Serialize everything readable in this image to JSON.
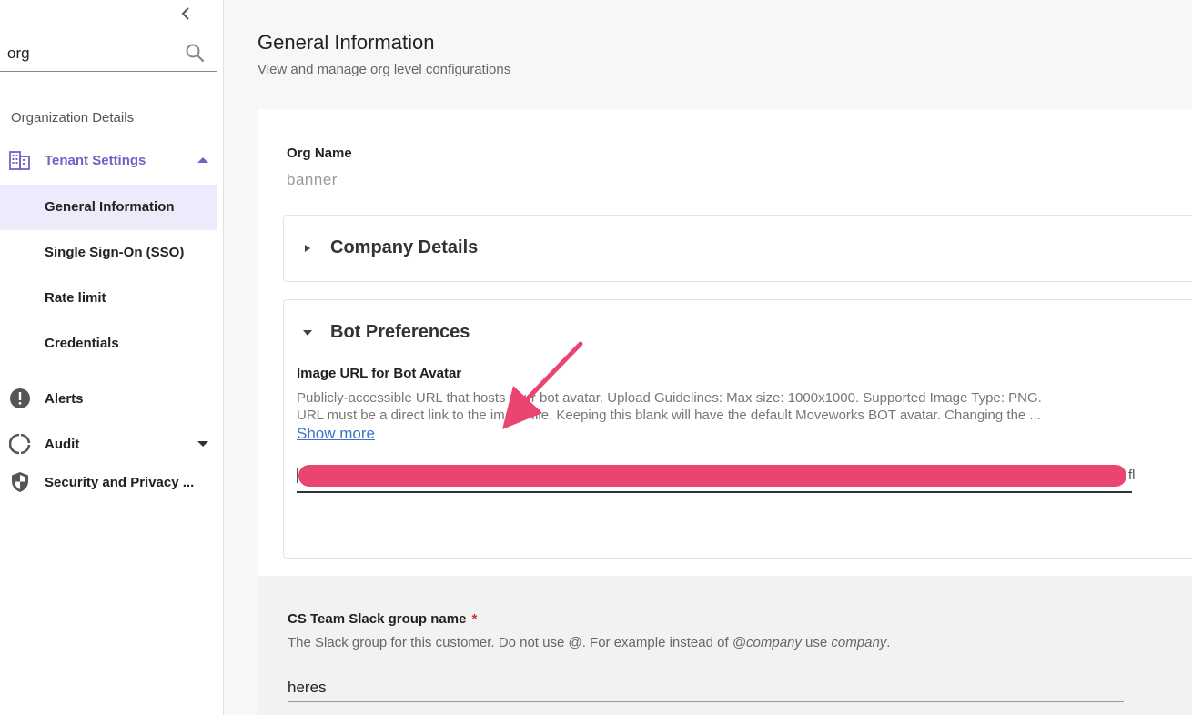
{
  "search": {
    "value": "org"
  },
  "sidebar": {
    "org_details": "Organization Details",
    "tenant_settings": "Tenant Settings",
    "sub_items": [
      "General Information",
      "Single Sign-On (SSO)",
      "Rate limit",
      "Credentials"
    ],
    "alerts": "Alerts",
    "audit": "Audit",
    "security": "Security and Privacy ..."
  },
  "header": {
    "title": "General Information",
    "subtitle": "View and manage org level configurations"
  },
  "org_name": {
    "label": "Org Name",
    "value": "banner"
  },
  "company_details": {
    "title": "Company Details"
  },
  "bot_preferences": {
    "title": "Bot Preferences",
    "avatar_label": "Image URL for Bot Avatar",
    "help_line1": "Publicly-accessible URL that hosts your bot avatar. Upload Guidelines: Max size: 1000x1000. Supported Image Type: PNG.",
    "help_line2": "URL must be a direct link to the image file. Keeping this blank will have the default Moveworks BOT avatar. Changing the ...",
    "show_more": "Show more",
    "url_tail": "fl"
  },
  "cs_team": {
    "label": "CS Team Slack group name",
    "required_mark": "*",
    "help_a": "The Slack group for this customer. Do not use @. For example instead of ",
    "help_b": "@company",
    "help_c": " use ",
    "help_d": "company",
    "help_e": ".",
    "value": "heres"
  },
  "colors": {
    "accent": "#7560c4",
    "selected_bg": "#efeafb",
    "annotation": "#ea4470",
    "link": "#3b73c8"
  }
}
